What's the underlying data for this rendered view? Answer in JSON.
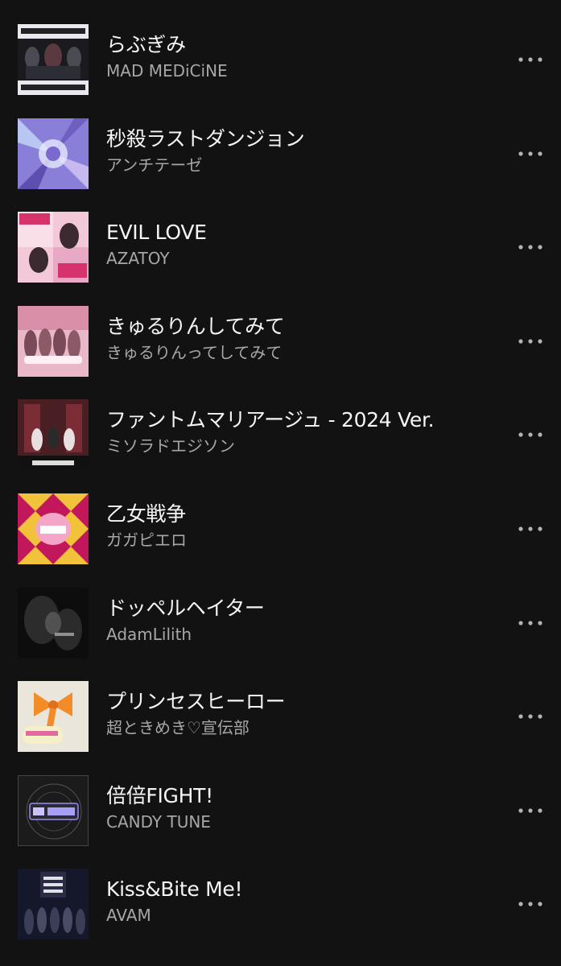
{
  "tracks": [
    {
      "title": "らぶぎみ",
      "artist": "MAD MEDiCiNE"
    },
    {
      "title": "秒殺ラストダンジョン",
      "artist": "アンチテーゼ"
    },
    {
      "title": "EVIL LOVE",
      "artist": "AZATOY"
    },
    {
      "title": "きゅるりんしてみて",
      "artist": "きゅるりんってしてみて"
    },
    {
      "title": "ファントムマリアージュ - 2024 Ver.",
      "artist": "ミソラドエジソン"
    },
    {
      "title": "乙女戦争",
      "artist": "ガガピエロ"
    },
    {
      "title": "ドッペルヘイター",
      "artist": "AdamLilith"
    },
    {
      "title": "プリンセスヒーロー",
      "artist": "超ときめき♡宣伝部"
    },
    {
      "title": "倍倍FIGHT!",
      "artist": "CANDY TUNE"
    },
    {
      "title": "Kiss&Bite Me!",
      "artist": "AVAM"
    }
  ],
  "colors": {
    "background": "#121212",
    "title": "#f5f5f5",
    "artist": "#a7a7a7",
    "more_dots": "#b3b3b3"
  },
  "icons": {
    "more": "more-options-icon"
  }
}
